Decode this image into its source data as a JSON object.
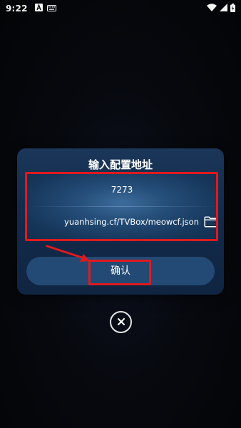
{
  "status_bar": {
    "time": "9:22",
    "icons": [
      "a-notification-icon",
      "keyboard-icon",
      "wifi-icon",
      "signal-icon",
      "battery-icon"
    ]
  },
  "dialog": {
    "title": "输入配置地址",
    "name_field_value": "7273",
    "url_field_value": "yuanhsing.cf/TVBox/meowcf.json",
    "folder_icon": "folder-icon",
    "confirm_label": "确认"
  },
  "close_icon": "close-icon",
  "colors": {
    "dialog_bg": "#12294a",
    "panel_highlight": "#3d6c9c",
    "confirm_bg": "#234a75",
    "annotation": "#e0191e"
  }
}
